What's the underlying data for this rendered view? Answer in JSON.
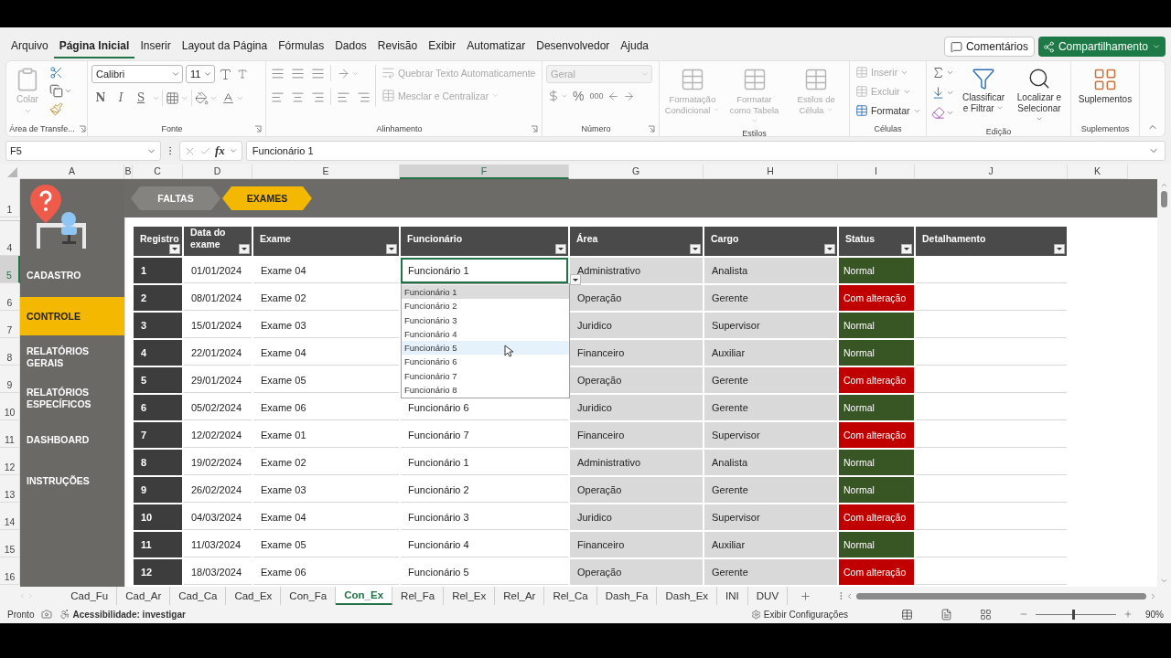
{
  "menu_tabs": [
    {
      "label": "Arquivo",
      "selected": false
    },
    {
      "label": "Página Inicial",
      "selected": true
    },
    {
      "label": "Inserir",
      "selected": false
    },
    {
      "label": "Layout da Página",
      "selected": false
    },
    {
      "label": "Fórmulas",
      "selected": false
    },
    {
      "label": "Dados",
      "selected": false
    },
    {
      "label": "Revisão",
      "selected": false
    },
    {
      "label": "Exibir",
      "selected": false
    },
    {
      "label": "Automatizar",
      "selected": false
    },
    {
      "label": "Desenvolvedor",
      "selected": false
    },
    {
      "label": "Ajuda",
      "selected": false
    }
  ],
  "header_buttons": {
    "comments": "Comentários",
    "share": "Compartilhamento"
  },
  "ribbon": {
    "groups": [
      {
        "kind": "clipboard",
        "label": "Área de Transfe...",
        "paste": {
          "label": "Colar",
          "disabled": true
        }
      },
      {
        "kind": "font",
        "label": "Fonte",
        "font": "Calibri",
        "size": "11",
        "styles": [
          "N",
          "I",
          "S"
        ]
      },
      {
        "kind": "alignment",
        "label": "Alinhamento",
        "wrap": {
          "label": "Quebrar Texto Automaticamente",
          "disabled": true
        },
        "merge": {
          "label": "Mesclar e Centralizar",
          "disabled": true
        }
      },
      {
        "kind": "number",
        "label": "Número",
        "format": {
          "value": "Geral",
          "disabled": true
        },
        "symbols": [
          "%",
          "000"
        ]
      },
      {
        "kind": "styles",
        "label": "Estilos",
        "buttons": [
          {
            "label": "Formatação Condicional",
            "disabled": true
          },
          {
            "label": "Formatar como Tabela",
            "disabled": true
          },
          {
            "label": "Estilos de Célula",
            "disabled": true
          }
        ]
      },
      {
        "kind": "cells",
        "label": "Células",
        "buttons": [
          {
            "label": "Inserir",
            "disabled": true
          },
          {
            "label": "Excluir",
            "disabled": true
          },
          {
            "label": "Formatar",
            "disabled": false
          }
        ]
      },
      {
        "kind": "editing",
        "label": "Edição",
        "buttons": [
          {
            "label": "Classificar e Filtrar",
            "disabled": false
          },
          {
            "label": "Localizar e Selecionar",
            "disabled": false
          }
        ]
      },
      {
        "kind": "addins",
        "label": "Suplementos",
        "button": {
          "label": "Suplementos",
          "disabled": false
        }
      }
    ]
  },
  "formula_bar": {
    "name_box": "F5",
    "fx": "fx",
    "formula": "Funcionário 1"
  },
  "columns": [
    {
      "label": "A",
      "selected": false
    },
    {
      "label": "B",
      "selected": false
    },
    {
      "label": "C",
      "selected": false
    },
    {
      "label": "D",
      "selected": false
    },
    {
      "label": "E",
      "selected": false
    },
    {
      "label": "F",
      "selected": true
    },
    {
      "label": "G",
      "selected": false
    },
    {
      "label": "H",
      "selected": false
    },
    {
      "label": "I",
      "selected": false
    },
    {
      "label": "J",
      "selected": false
    },
    {
      "label": "K",
      "selected": false
    }
  ],
  "row_numbers": [
    {
      "label": "1",
      "selected": false
    },
    {
      "label": "4",
      "selected": false
    },
    {
      "label": "5",
      "selected": true
    },
    {
      "label": "6",
      "selected": false
    },
    {
      "label": "7",
      "selected": false
    },
    {
      "label": "8",
      "selected": false
    },
    {
      "label": "9",
      "selected": false
    },
    {
      "label": "10",
      "selected": false
    },
    {
      "label": "11",
      "selected": false
    },
    {
      "label": "12",
      "selected": false
    },
    {
      "label": "13",
      "selected": false
    },
    {
      "label": "14",
      "selected": false
    },
    {
      "label": "15",
      "selected": false
    },
    {
      "label": "16",
      "selected": false
    }
  ],
  "sidebar": {
    "items": [
      {
        "label": "CADASTRO",
        "selected": false
      },
      {
        "label": "CONTROLE",
        "selected": true
      },
      {
        "label": "RELATÓRIOS GERAIS",
        "selected": false
      },
      {
        "label": "RELATÓRIOS ESPECÍFICOS",
        "selected": false
      },
      {
        "label": "DASHBOARD",
        "selected": false
      },
      {
        "label": "INSTRUÇÕES",
        "selected": false
      }
    ]
  },
  "nav_tabs": [
    {
      "label": "FALTAS",
      "selected": false
    },
    {
      "label": "EXAMES",
      "selected": true
    }
  ],
  "table": {
    "columns": [
      "Registro",
      "Data do exame",
      "Exame",
      "Funcionário",
      "Área",
      "Cargo",
      "Status",
      "Detalhamento"
    ],
    "rows": [
      {
        "registro": "1",
        "data": "01/01/2024",
        "exame": "Exame 04",
        "funcionario": "Funcionário 1",
        "area": "Administrativo",
        "cargo": "Analista",
        "status": {
          "text": "Normal",
          "color": "#375623"
        },
        "editing": true
      },
      {
        "registro": "2",
        "data": "08/01/2024",
        "exame": "Exame 02",
        "area": "Operação",
        "cargo": "Gerente",
        "status": {
          "text": "Com alteração",
          "color": "#c00000"
        },
        "editing": false
      },
      {
        "registro": "3",
        "data": "15/01/2024",
        "exame": "Exame 03",
        "area": "Juridico",
        "cargo": "Supervisor",
        "status": {
          "text": "Normal",
          "color": "#375623"
        },
        "editing": false
      },
      {
        "registro": "4",
        "data": "22/01/2024",
        "exame": "Exame 04",
        "area": "Financeiro",
        "cargo": "Auxiliar",
        "status": {
          "text": "Normal",
          "color": "#375623"
        },
        "editing": false
      },
      {
        "registro": "5",
        "data": "29/01/2024",
        "exame": "Exame 05",
        "area": "Operação",
        "cargo": "Gerente",
        "status": {
          "text": "Com alteração",
          "color": "#c00000"
        },
        "editing": false
      },
      {
        "registro": "6",
        "data": "05/02/2024",
        "exame": "Exame 06",
        "funcionario": "Funcionário 6",
        "area": "Juridico",
        "cargo": "Gerente",
        "status": {
          "text": "Normal",
          "color": "#375623"
        },
        "editing": false
      },
      {
        "registro": "7",
        "data": "12/02/2024",
        "exame": "Exame 01",
        "funcionario": "Funcionário 7",
        "area": "Financeiro",
        "cargo": "Supervisor",
        "status": {
          "text": "Com alteração",
          "color": "#c00000"
        },
        "editing": false
      },
      {
        "registro": "8",
        "data": "19/02/2024",
        "exame": "Exame 02",
        "funcionario": "Funcionário 1",
        "area": "Administrativo",
        "cargo": "Analista",
        "status": {
          "text": "Normal",
          "color": "#375623"
        },
        "editing": false
      },
      {
        "registro": "9",
        "data": "26/02/2024",
        "exame": "Exame 03",
        "funcionario": "Funcionário 2",
        "area": "Operação",
        "cargo": "Gerente",
        "status": {
          "text": "Normal",
          "color": "#375623"
        },
        "editing": false
      },
      {
        "registro": "10",
        "data": "04/03/2024",
        "exame": "Exame 04",
        "funcionario": "Funcionário 3",
        "area": "Juridico",
        "cargo": "Supervisor",
        "status": {
          "text": "Com alteração",
          "color": "#c00000"
        },
        "editing": false
      },
      {
        "registro": "11",
        "data": "11/03/2024",
        "exame": "Exame 05",
        "funcionario": "Funcionário 4",
        "area": "Financeiro",
        "cargo": "Auxiliar",
        "status": {
          "text": "Normal",
          "color": "#375623"
        },
        "editing": false
      },
      {
        "registro": "12",
        "data": "18/03/2024",
        "exame": "Exame 06",
        "funcionario": "Funcionário 5",
        "area": "Operação",
        "cargo": "Gerente",
        "status": {
          "text": "Com alteração",
          "color": "#c00000"
        },
        "editing": false
      }
    ],
    "dropdown": [
      {
        "label": "Funcionário 1",
        "selected": true,
        "hovered": false
      },
      {
        "label": "Funcionário 2",
        "selected": false,
        "hovered": false
      },
      {
        "label": "Funcionário 3",
        "selected": false,
        "hovered": false
      },
      {
        "label": "Funcionário 4",
        "selected": false,
        "hovered": false
      },
      {
        "label": "Funcionário 5",
        "selected": false,
        "hovered": true
      },
      {
        "label": "Funcionário 6",
        "selected": false,
        "hovered": false
      },
      {
        "label": "Funcionário 7",
        "selected": false,
        "hovered": false
      },
      {
        "label": "Funcionário 8",
        "selected": false,
        "hovered": false
      }
    ]
  },
  "sheet_tabs": [
    {
      "label": "Cad_Fu",
      "selected": false
    },
    {
      "label": "Cad_Ar",
      "selected": false
    },
    {
      "label": "Cad_Ca",
      "selected": false
    },
    {
      "label": "Cad_Ex",
      "selected": false
    },
    {
      "label": "Con_Fa",
      "selected": false
    },
    {
      "label": "Con_Ex",
      "selected": true
    },
    {
      "label": "Rel_Fa",
      "selected": false
    },
    {
      "label": "Rel_Ex",
      "selected": false
    },
    {
      "label": "Rel_Ar",
      "selected": false
    },
    {
      "label": "Rel_Ca",
      "selected": false
    },
    {
      "label": "Dash_Fa",
      "selected": false
    },
    {
      "label": "Dash_Ex",
      "selected": false
    },
    {
      "label": "INI",
      "selected": false
    },
    {
      "label": "DUV",
      "selected": false
    }
  ],
  "status_bar": {
    "ready": "Pronto",
    "accessibility": "Acessibilidade: investigar",
    "view_settings": "Exibir Configurações",
    "zoom_slider": {
      "level": 0.47
    },
    "zoom": "90%"
  }
}
